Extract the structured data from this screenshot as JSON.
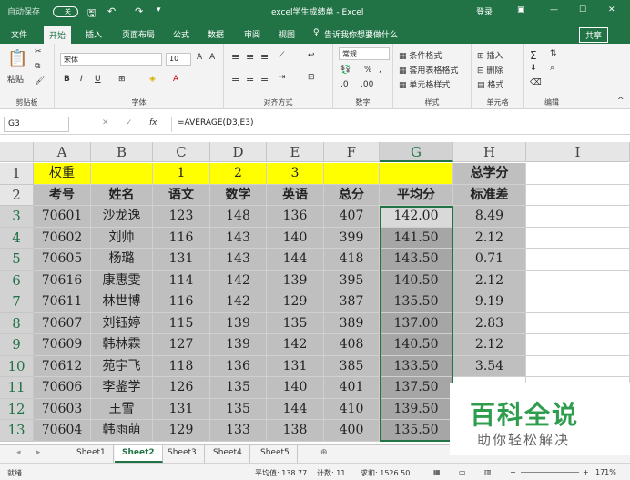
{
  "titlebar": {
    "autosave": "自动保存",
    "autosave_state": "关",
    "title": "excel学生成绩单 - Excel",
    "login": "登录"
  },
  "tabs": [
    "文件",
    "开始",
    "插入",
    "页面布局",
    "公式",
    "数据",
    "审阅",
    "视图"
  ],
  "tellme": "告诉我你想要做什么",
  "share": "共享",
  "ribbon": {
    "clipboard": "剪贴板",
    "paste": "粘贴",
    "font_group": "字体",
    "font_name": "宋体",
    "font_size": "10",
    "align_group": "对齐方式",
    "number_group": "数字",
    "number_format": "常规",
    "styles_group": "样式",
    "cond_format": "条件格式",
    "table_format": "套用表格格式",
    "cell_style": "单元格样式",
    "cells_group": "单元格",
    "insert": "插入",
    "delete": "删除",
    "format": "格式",
    "edit_group": "编辑"
  },
  "formula": {
    "namebox": "G3",
    "fx": "fx",
    "value": "=AVERAGE(D3,E3)"
  },
  "columns": [
    "A",
    "B",
    "C",
    "D",
    "E",
    "F",
    "G",
    "H",
    "I"
  ],
  "rows": [
    "1",
    "2",
    "3",
    "4",
    "5",
    "6",
    "7",
    "8",
    "9",
    "10",
    "11",
    "12",
    "13"
  ],
  "row1": [
    "权重",
    "",
    "1",
    "2",
    "3",
    "",
    "",
    "总学分",
    ""
  ],
  "row2": [
    "考号",
    "姓名",
    "语文",
    "数学",
    "英语",
    "总分",
    "平均分",
    "标准差",
    ""
  ],
  "data": [
    [
      "70601",
      "沙龙逸",
      "123",
      "148",
      "136",
      "407",
      "142.00",
      "8.49"
    ],
    [
      "70602",
      "刘帅",
      "116",
      "143",
      "140",
      "399",
      "141.50",
      "2.12"
    ],
    [
      "70605",
      "杨璐",
      "131",
      "143",
      "144",
      "418",
      "143.50",
      "0.71"
    ],
    [
      "70616",
      "康惠雯",
      "114",
      "142",
      "139",
      "395",
      "140.50",
      "2.12"
    ],
    [
      "70611",
      "林世博",
      "116",
      "142",
      "129",
      "387",
      "135.50",
      "9.19"
    ],
    [
      "70607",
      "刘钰婷",
      "115",
      "139",
      "135",
      "389",
      "137.00",
      "2.83"
    ],
    [
      "70609",
      "韩林霖",
      "127",
      "139",
      "142",
      "408",
      "140.50",
      "2.12"
    ],
    [
      "70612",
      "苑宇飞",
      "118",
      "136",
      "131",
      "385",
      "133.50",
      "3.54"
    ],
    [
      "70606",
      "李鉴学",
      "126",
      "135",
      "140",
      "401",
      "137.50",
      ""
    ],
    [
      "70603",
      "王雪",
      "131",
      "135",
      "144",
      "410",
      "139.50",
      ""
    ],
    [
      "70604",
      "韩雨萌",
      "129",
      "133",
      "138",
      "400",
      "135.50",
      ""
    ]
  ],
  "sheets": [
    "Sheet1",
    "Sheet2",
    "Sheet3",
    "Sheet4",
    "Sheet5"
  ],
  "status": {
    "ready": "就绪",
    "avg": "平均值: 138.77",
    "count": "计数: 11",
    "sum": "求和: 1526.50",
    "zoom": "171%"
  },
  "watermark": {
    "line1": "百科全说",
    "line2": "助你轻松解决"
  },
  "colors": {
    "accent": "#217346",
    "yellow": "#ffff00",
    "gray": "#bfbfbf",
    "selection": "#a6a6a6"
  }
}
